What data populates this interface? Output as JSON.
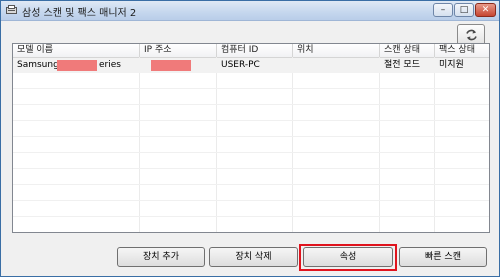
{
  "window": {
    "title": "삼성 스캔 및 팩스 매니저 2",
    "controls": {
      "minimize": "–",
      "maximize": "□",
      "close": "✕"
    }
  },
  "toolbar": {
    "refresh_icon": "refresh-icon"
  },
  "table": {
    "columns": [
      "모델 이름",
      "IP 주소",
      "컴퓨터 ID",
      "위치",
      "스캔 상태",
      "팩스 상태"
    ],
    "rows": [
      {
        "model_prefix": "Samsung",
        "model_suffix": "eries",
        "ip": "",
        "computer_id": "USER-PC",
        "location": "",
        "scan_status": "절전 모드",
        "fax_status": "미지원"
      }
    ]
  },
  "buttons": {
    "add": "장치 추가",
    "delete": "장치 삭제",
    "properties": "속성",
    "quick_scan": "빠른 스캔"
  },
  "colors": {
    "highlight": "#e0141e",
    "redaction": "#f07a7a"
  }
}
